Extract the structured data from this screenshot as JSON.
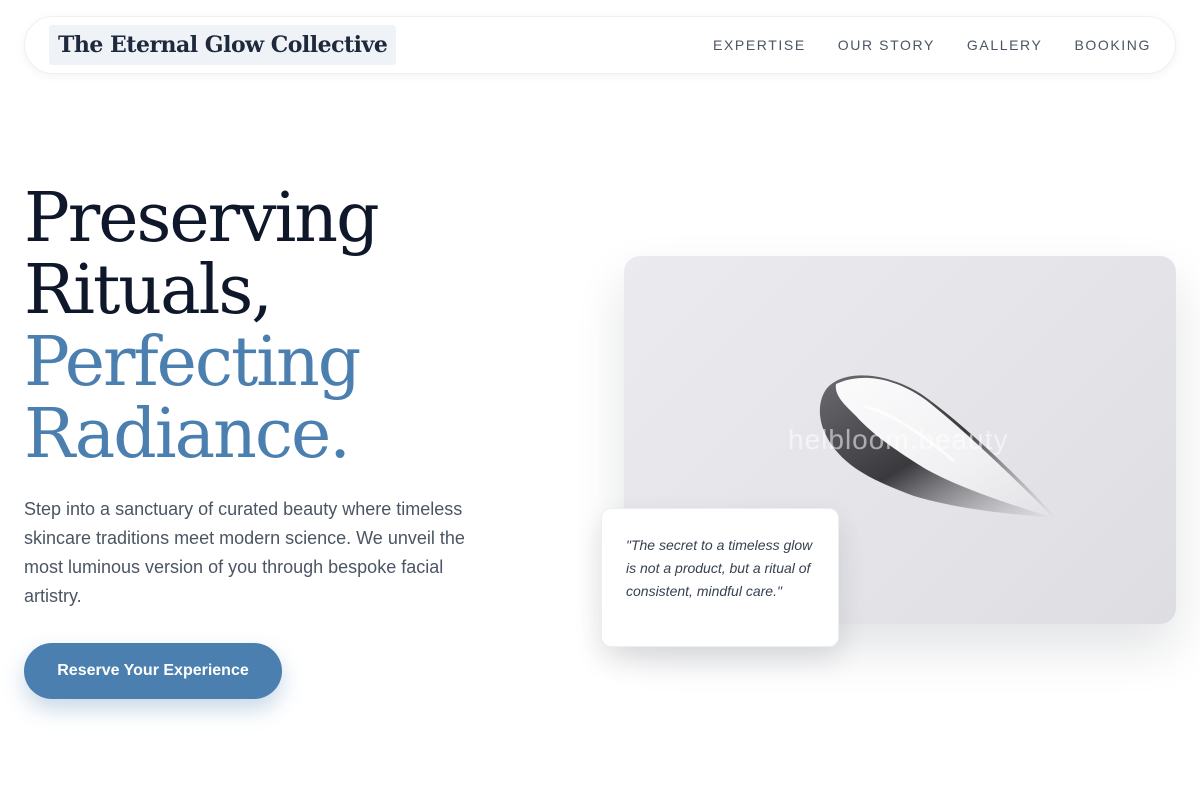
{
  "header": {
    "brand": "The Eternal Glow Collective",
    "nav": [
      {
        "label": "EXPERTISE"
      },
      {
        "label": "OUR STORY"
      },
      {
        "label": "GALLERY"
      },
      {
        "label": "BOOKING"
      }
    ]
  },
  "hero": {
    "headline_line1": "Preserving",
    "headline_line2": "Rituals,",
    "headline_line3": "Perfecting",
    "headline_line4": "Radiance.",
    "lede": "Step into a sanctuary of curated beauty where timeless skincare traditions meet modern science. We unveil the most luminous version of you through bespoke facial artistry.",
    "cta_label": "Reserve Your Experience",
    "image_watermark": "helbloom.beauty",
    "quote": "\"The secret to a timeless glow is not a product, but a ritual of consistent, mindful care.\""
  },
  "colors": {
    "accent": "#4a7fb0",
    "heading": "#0f172a",
    "body_text": "#4b5563"
  }
}
